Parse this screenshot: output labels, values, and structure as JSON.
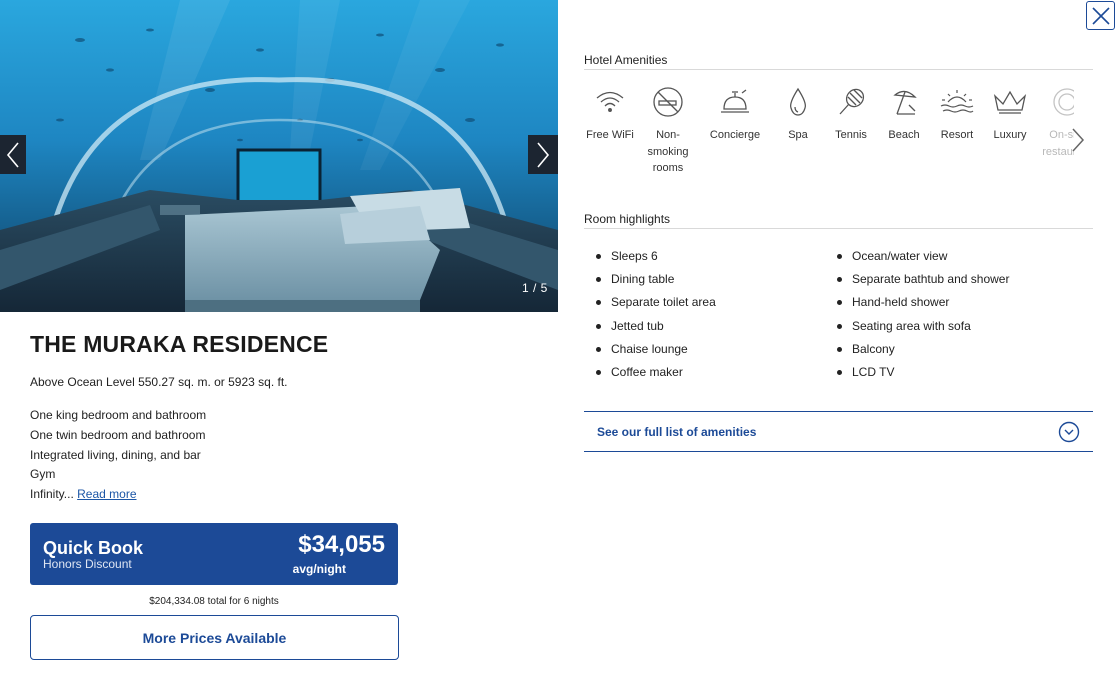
{
  "gallery": {
    "counter": "1 / 5",
    "current": 1,
    "total": 5
  },
  "room": {
    "title": "THE MURAKA RESIDENCE",
    "size": "Above Ocean Level 550.27 sq. m. or 5923 sq. ft.",
    "description": [
      "One king bedroom and bathroom",
      "One twin bedroom and bathroom",
      "Integrated living, dining, and bar",
      "Gym"
    ],
    "description_truncated": "Infinity...",
    "read_more": "Read more"
  },
  "quick_book": {
    "title": "Quick Book",
    "subtitle": "Honors Discount",
    "price": "$34,055",
    "unit": "avg/night",
    "total": "$204,334.08 total for 6 nights"
  },
  "more_prices": "More Prices Available",
  "amenities": {
    "heading": "Hotel Amenities",
    "items": [
      {
        "icon": "wifi-icon",
        "label": "Free WiFi"
      },
      {
        "icon": "no-smoking-icon",
        "label": "Non-smoking rooms"
      },
      {
        "icon": "concierge-bell-icon",
        "label": "Concierge"
      },
      {
        "icon": "spa-drop-icon",
        "label": "Spa"
      },
      {
        "icon": "tennis-racket-icon",
        "label": "Tennis"
      },
      {
        "icon": "beach-umbrella-icon",
        "label": "Beach"
      },
      {
        "icon": "resort-sun-icon",
        "label": "Resort"
      },
      {
        "icon": "luxury-crown-icon",
        "label": "Luxury"
      },
      {
        "icon": "on-site-restaurant-icon",
        "label": "On-site restaurant"
      }
    ]
  },
  "highlights": {
    "heading": "Room highlights",
    "left": [
      "Sleeps 6",
      "Dining table",
      "Separate toilet area",
      "Jetted tub",
      "Chaise lounge",
      "Coffee maker"
    ],
    "right": [
      "Ocean/water view",
      "Separate bathtub and shower",
      "Hand-held shower",
      "Seating area with sofa",
      "Balcony",
      "LCD TV"
    ]
  },
  "full_list": "See our full list of amenities",
  "colors": {
    "brand_blue": "#1c4a97",
    "link_blue": "#1c56a6",
    "water": "#1f8fc6"
  }
}
